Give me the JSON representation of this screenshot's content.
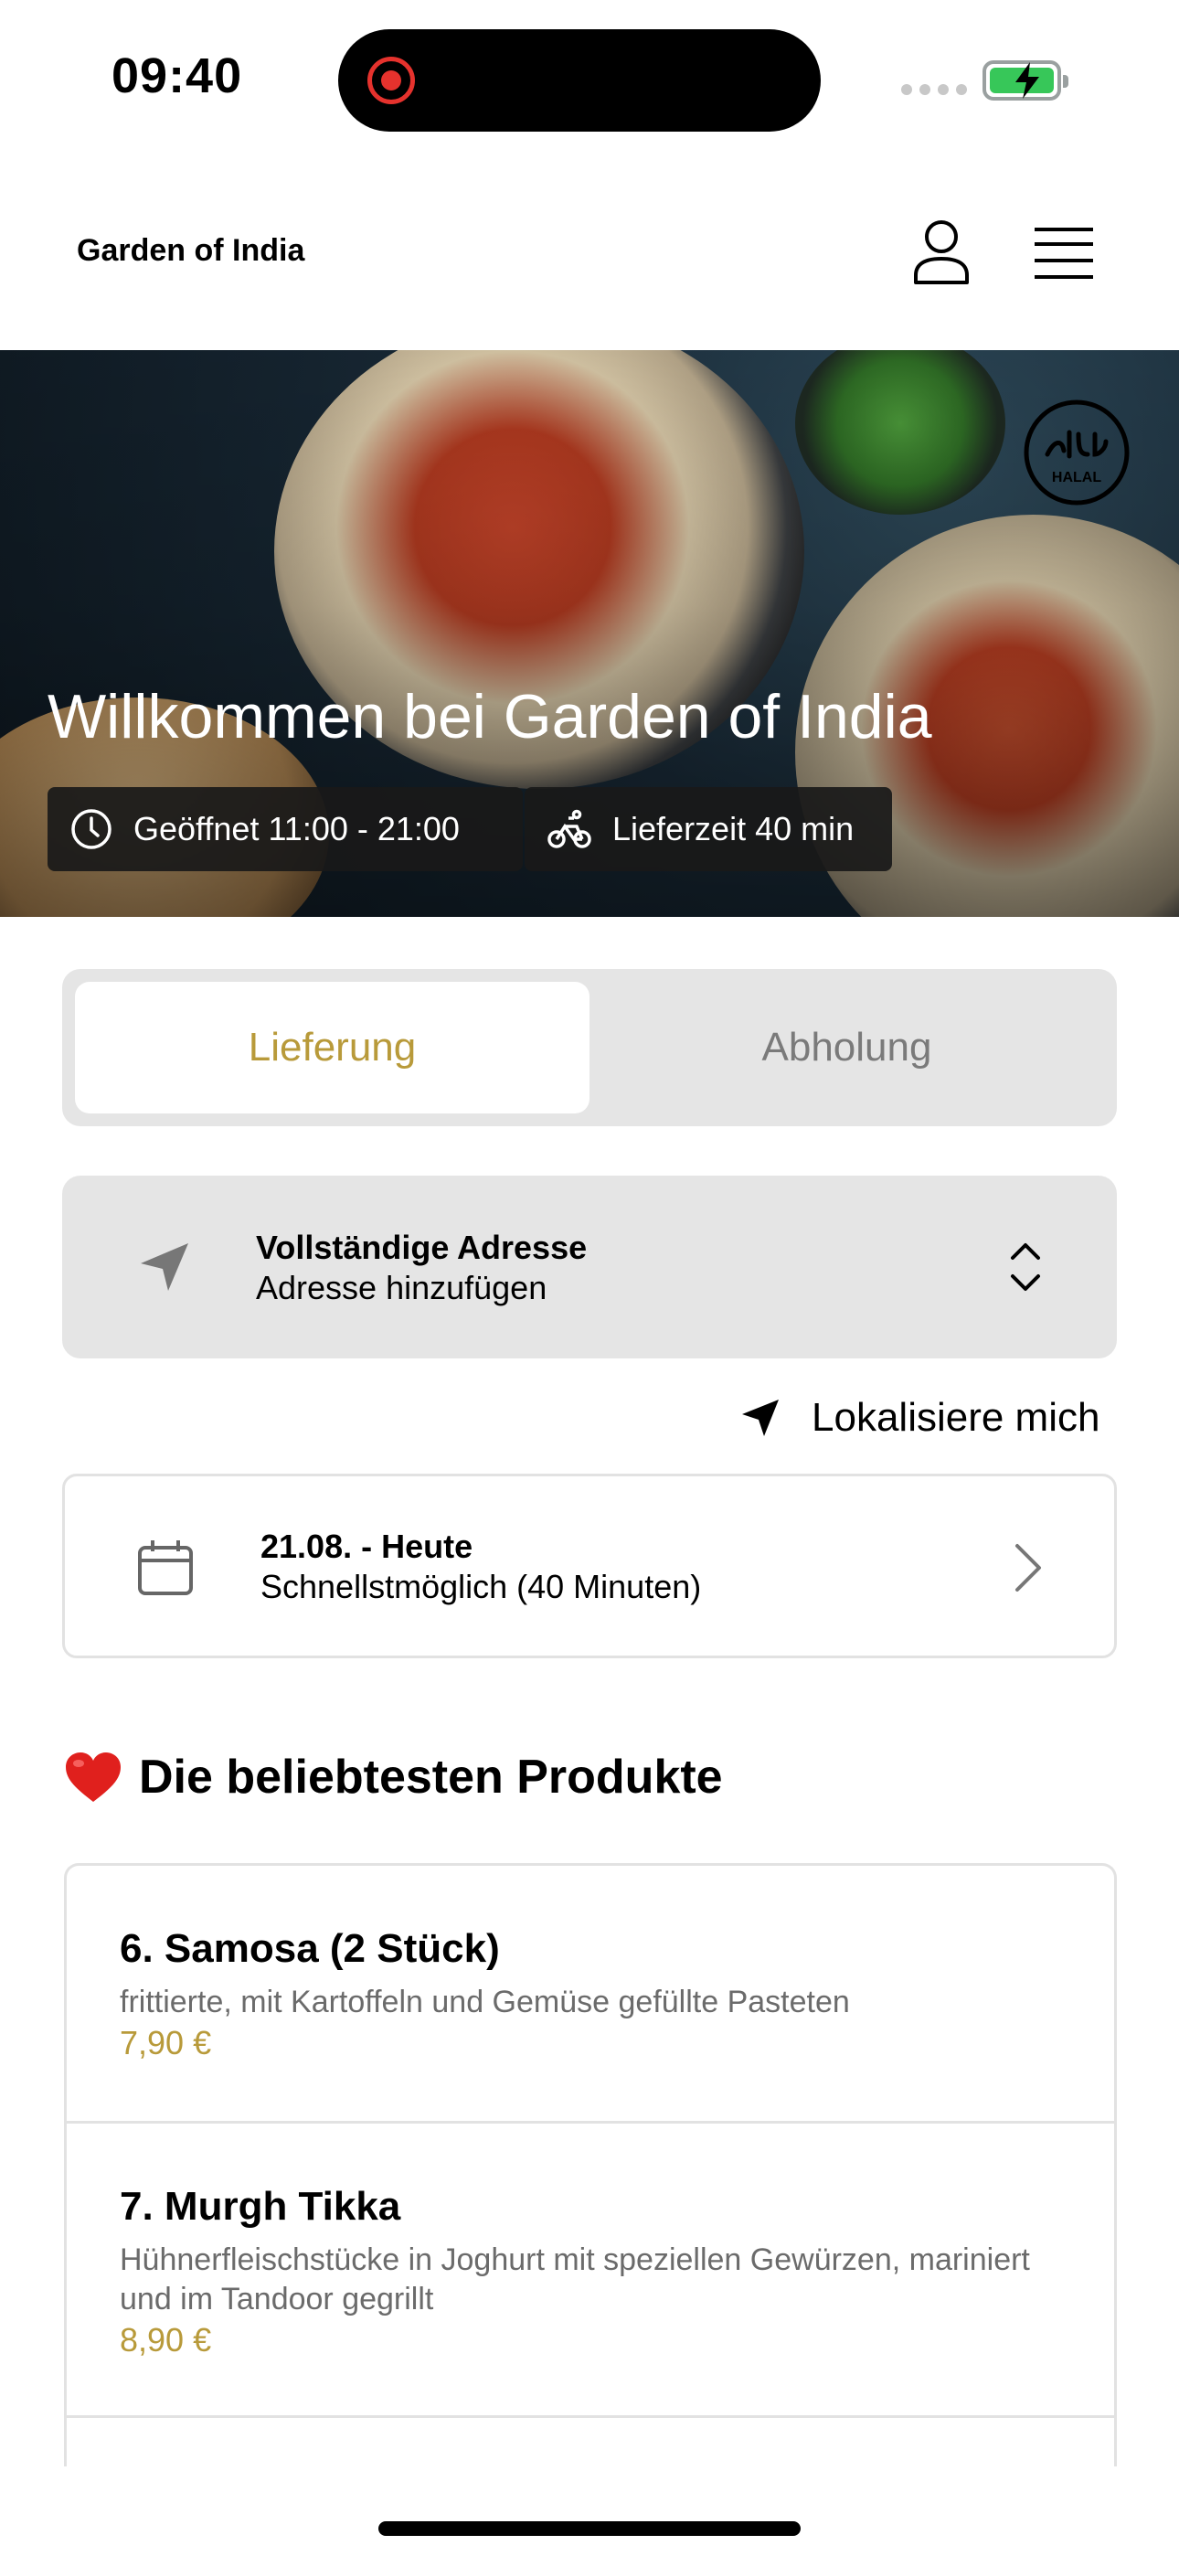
{
  "status_bar": {
    "time": "09:40"
  },
  "header": {
    "brand": "Garden of India"
  },
  "hero": {
    "title": "Willkommen bei Garden of India",
    "badge_text": "HALAL",
    "open_hours": "Geöffnet 11:00 - 21:00",
    "delivery_time": "Lieferzeit 40 min"
  },
  "order_mode": {
    "options": [
      "Lieferung",
      "Abholung"
    ],
    "selected": "Lieferung"
  },
  "address": {
    "title": "Vollständige Adresse",
    "subtitle": "Adresse hinzufügen",
    "locate_label": "Lokalisiere mich"
  },
  "schedule": {
    "date": "21.08. - Heute",
    "time": "Schnellstmöglich (40 Minuten)"
  },
  "popular": {
    "heading": "Die beliebtesten Produkte",
    "items": [
      {
        "name": "6. Samosa (2 Stück)",
        "description": "frittierte, mit Kartoffeln und Gemüse gefüllte Pasteten",
        "price": "7,90 €"
      },
      {
        "name": "7. Murgh Tikka",
        "description": "Hühnerfleischstücke in Joghurt mit speziellen Gewürzen, mariniert und im Tandoor gegrillt",
        "price": "8,90 €"
      }
    ]
  },
  "colors": {
    "accent": "#b89a3a",
    "recording": "#e5322d",
    "battery": "#37c759",
    "card_bg": "#e5e5e5"
  },
  "icons": [
    "record-icon",
    "battery-icon",
    "user-icon",
    "menu-icon",
    "halal-badge-icon",
    "clock-icon",
    "bicycle-icon",
    "location-arrow-icon",
    "chevron-up-down-icon",
    "calendar-icon",
    "chevron-right-icon",
    "heart-icon"
  ]
}
